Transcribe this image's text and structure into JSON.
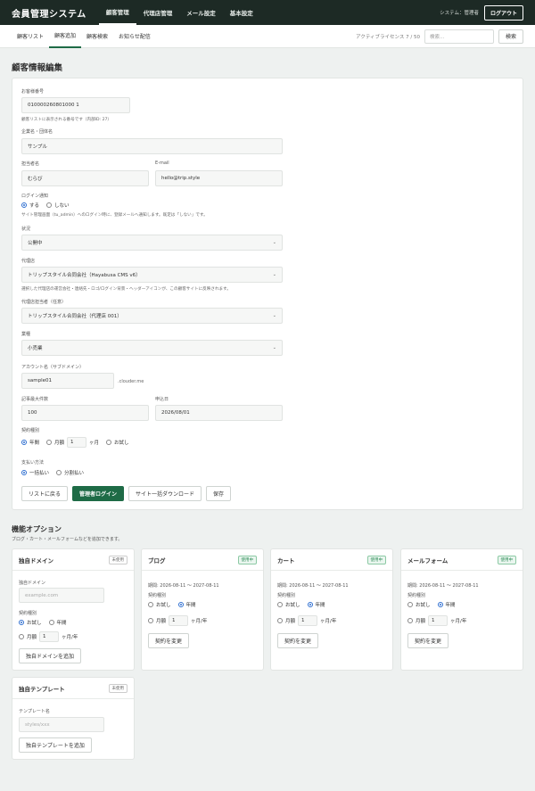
{
  "header": {
    "logo": "会員管理システム",
    "nav": [
      "顧客管理",
      "代理店管理",
      "メール設定",
      "基本設定"
    ],
    "system_label": "システム：管理者",
    "logout": "ログアウト"
  },
  "subnav": {
    "items": [
      "顧客リスト",
      "顧客追加",
      "顧客検索",
      "お知らせ配信"
    ],
    "license": "アクティブライセンス 7 / 50",
    "search_placeholder": "検索...",
    "search_button": "検索"
  },
  "page_title": "顧客情報編集",
  "form": {
    "customer_no_label": "お客様番号",
    "customer_no": "010000260801000 1",
    "customer_no_hint": "顧客リストに表示される番号です（内部ID: 27）",
    "company_label": "企業名・団体名",
    "company": "サンプル",
    "contact_label": "担当者名",
    "contact": "むらび",
    "email_label": "E-mail",
    "email": "hello@trip.style",
    "login_notify_label": "ログイン通知",
    "login_notify_options": [
      "する",
      "しない"
    ],
    "login_notify_hint": "サイト管理画面（tu_admin）へのログイン時に、登録メールへ通知します。既定は「しない」です。",
    "status_label": "状況",
    "status": "公開中",
    "agency_label": "代理店",
    "agency": "トリップスタイル合同会社（Hayabusa CMS v6）",
    "agency_hint": "選択した代理店の運営会社・連絡先・ロゴ/ログイン背景・ヘッダーアイコンが、この顧客サイトに反映されます。",
    "agency_staff_label": "代理店担当者（任意）",
    "agency_staff": "トリップスタイル合同会社（代理店 001）",
    "industry_label": "業種",
    "industry": "小売業",
    "account_label": "アカウント名（サブドメイン）",
    "account": "sample01",
    "account_suffix": ".clouder.me",
    "max_posts_label": "記事最大件数",
    "max_posts": "100",
    "apply_date_label": "申込日",
    "apply_date": "2026/08/01",
    "contract_label": "契約種別",
    "contract_year": "年間",
    "contract_month": "月額",
    "contract_month_value": "1",
    "contract_month_unit": "ヶ月",
    "contract_trial": "お試し",
    "payment_label": "支払い方法",
    "payment_options": [
      "一括払い",
      "分割払い"
    ],
    "buttons": [
      "リストに戻る",
      "管理者ログイン",
      "サイト一括ダウンロード",
      "保存"
    ]
  },
  "features": {
    "title": "機能オプション",
    "subtitle": "ブログ・カート・メールフォームなどを追加できます。",
    "domain": {
      "name": "独自ドメイン",
      "badge": "未使用",
      "field_label": "独自ドメイン",
      "placeholder": "example.com",
      "contract_label": "契約種別",
      "trial": "お試し",
      "year": "年間",
      "month": "月額",
      "month_value": "1",
      "unit": "ヶ月/年",
      "button": "独自ドメインを追加"
    },
    "blog": {
      "name": "ブログ",
      "badge": "使用中",
      "period": "期間: 2026-08-11 〜 2027-08-11",
      "contract_label": "契約種別",
      "trial": "お試し",
      "year": "年間",
      "month": "月額",
      "month_value": "1",
      "unit": "ヶ月/年",
      "button": "契約を変更"
    },
    "cart": {
      "name": "カート",
      "badge": "使用中",
      "period": "期間: 2026-08-11 〜 2027-08-11",
      "contract_label": "契約種別",
      "trial": "お試し",
      "year": "年間",
      "month": "月額",
      "month_value": "1",
      "unit": "ヶ月/年",
      "button": "契約を変更"
    },
    "mailform": {
      "name": "メールフォーム",
      "badge": "使用中",
      "period": "期間: 2026-08-11 〜 2027-08-11",
      "contract_label": "契約種別",
      "trial": "お試し",
      "year": "年間",
      "month": "月額",
      "month_value": "1",
      "unit": "ヶ月/年",
      "button": "契約を変更"
    },
    "template": {
      "name": "独自テンプレート",
      "badge": "未使用",
      "field_label": "テンプレート名",
      "placeholder": "styles/xxx",
      "button": "独自テンプレートを追加"
    }
  }
}
